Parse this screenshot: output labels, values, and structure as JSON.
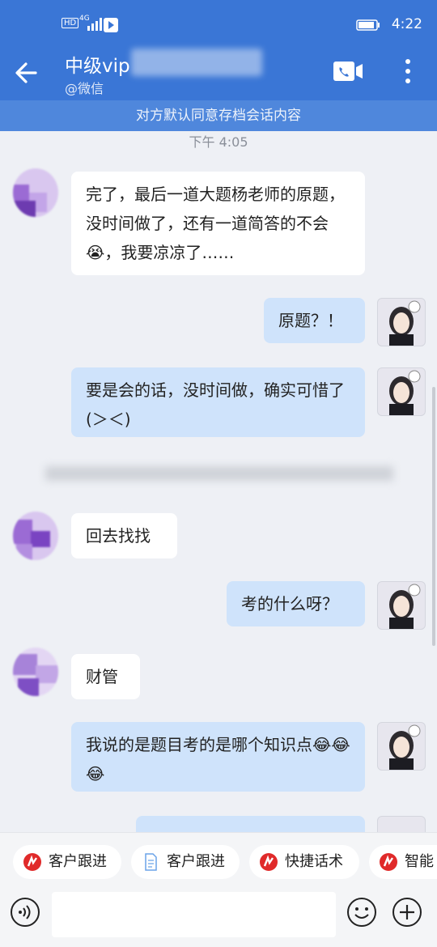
{
  "status": {
    "network": "4G",
    "hd": "HD",
    "time": "4:22"
  },
  "header": {
    "title": "中级vip",
    "subtitle": "@微信"
  },
  "notice": "对方默认同意存档会话内容",
  "timestamp": "下午 4:05",
  "messages": [
    {
      "side": "in",
      "text": "完了，最后一道大题杨老师的原题，没时间做了，还有一道简答的不会😭，我要凉凉了……"
    },
    {
      "side": "out",
      "text": "原题？！"
    },
    {
      "side": "out",
      "text": "要是会的话，没时间做，确实可惜了(＞＜)"
    },
    {
      "side": "in",
      "text": "回去找找"
    },
    {
      "side": "out",
      "text": "考的什么呀？"
    },
    {
      "side": "in",
      "text": "财管"
    },
    {
      "side": "out",
      "text": "我说的是题目考的是哪个知识点😂😂😂"
    }
  ],
  "quick_actions": [
    {
      "label": "客户跟进",
      "icon": "brand-logo-icon"
    },
    {
      "label": "客户跟进",
      "icon": "document-icon"
    },
    {
      "label": "快捷话术",
      "icon": "brand-logo-icon"
    },
    {
      "label": "智能",
      "icon": "brand-logo-icon"
    }
  ],
  "input": {
    "value": "",
    "placeholder": ""
  },
  "colors": {
    "header": "#3a76d6",
    "notice": "#4f87dc",
    "incoming": "#ffffff",
    "outgoing": "#cfe3fb",
    "brand_red": "#e02a2a"
  }
}
